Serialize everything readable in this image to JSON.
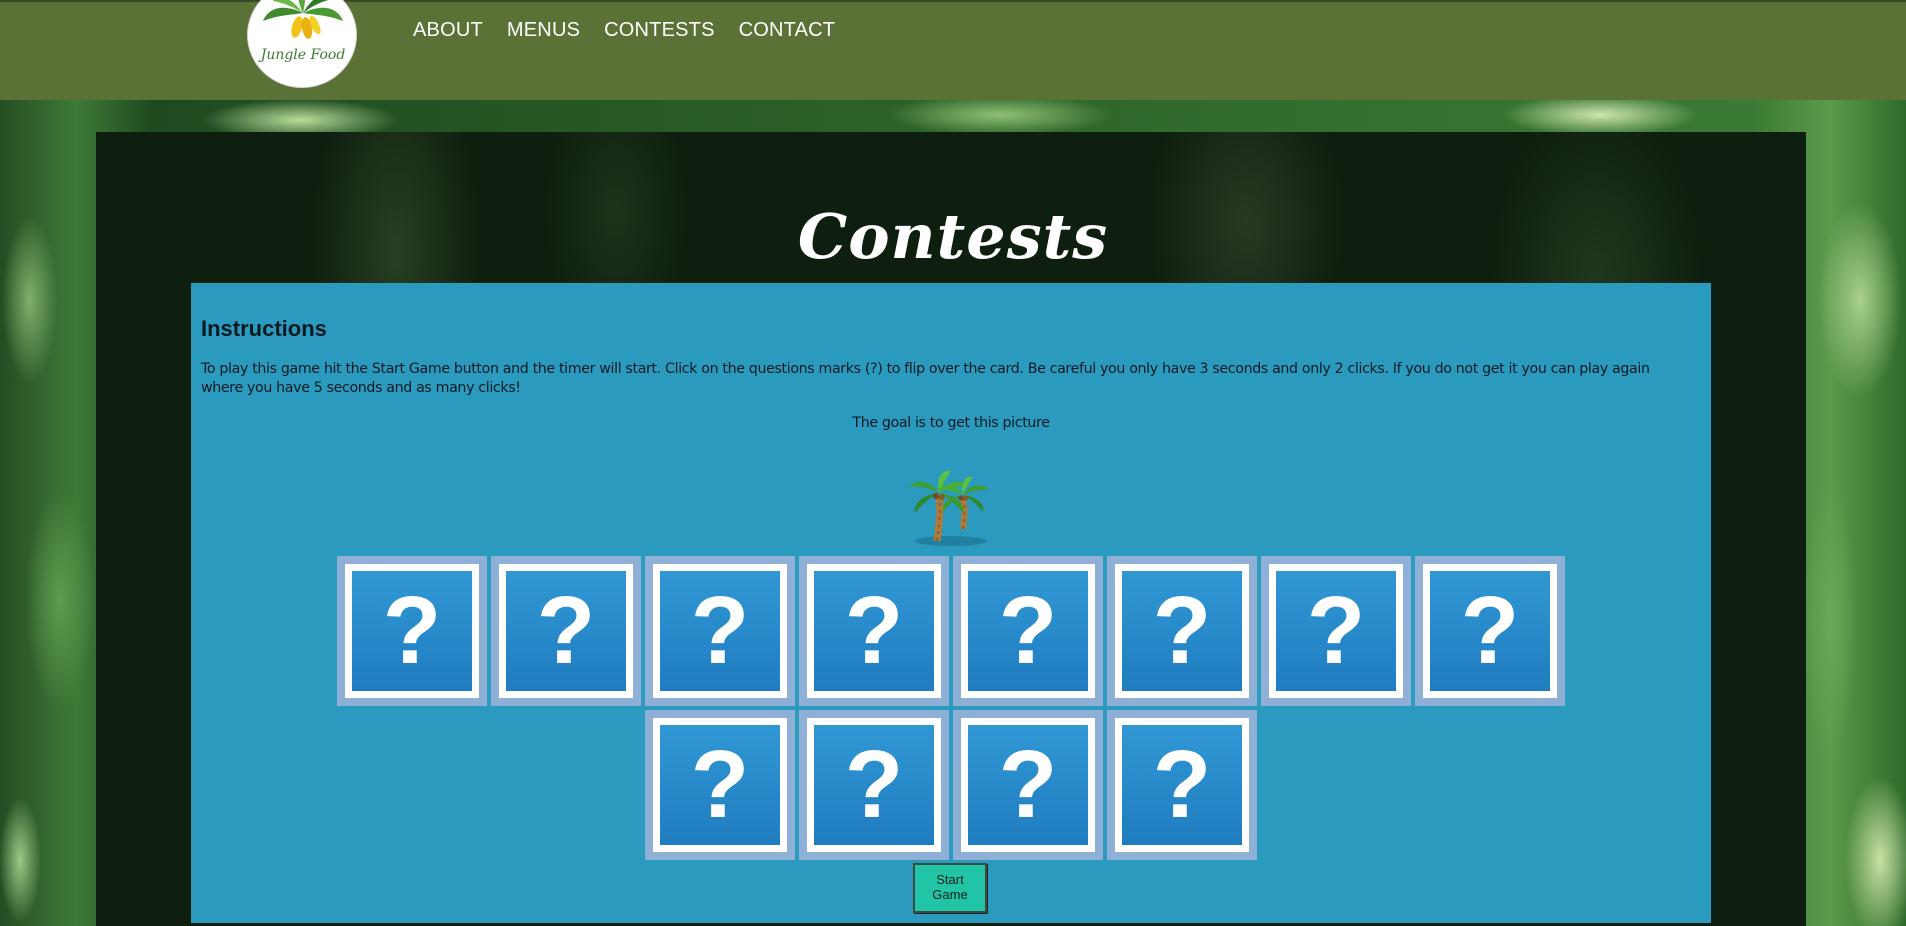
{
  "header": {
    "logo_text": "Jungle Food",
    "nav": [
      {
        "label": "ABOUT"
      },
      {
        "label": "MENUS"
      },
      {
        "label": "CONTESTS"
      },
      {
        "label": "CONTACT"
      }
    ]
  },
  "page": {
    "title": "Contests"
  },
  "instructions": {
    "heading": "Instructions",
    "text": "To play this game hit the Start Game button and the timer will start. Click on the questions marks (?) to flip over the card. Be careful you only have 3 seconds and only 2 clicks. If you do not get it you can play again where you have 5 seconds and as many clicks!",
    "goal": "The goal is to get this picture",
    "goal_image_icon": "palm-trees-icon"
  },
  "game": {
    "card_symbol": "?",
    "row1_count": 8,
    "row2_count": 4,
    "start_label_line1": "Start",
    "start_label_line2": "Game"
  },
  "colors": {
    "header_bg": "#5b7237",
    "content_bg": "#2a9abf",
    "card_face": "#2789cb",
    "button_bg": "#22c4a6"
  }
}
